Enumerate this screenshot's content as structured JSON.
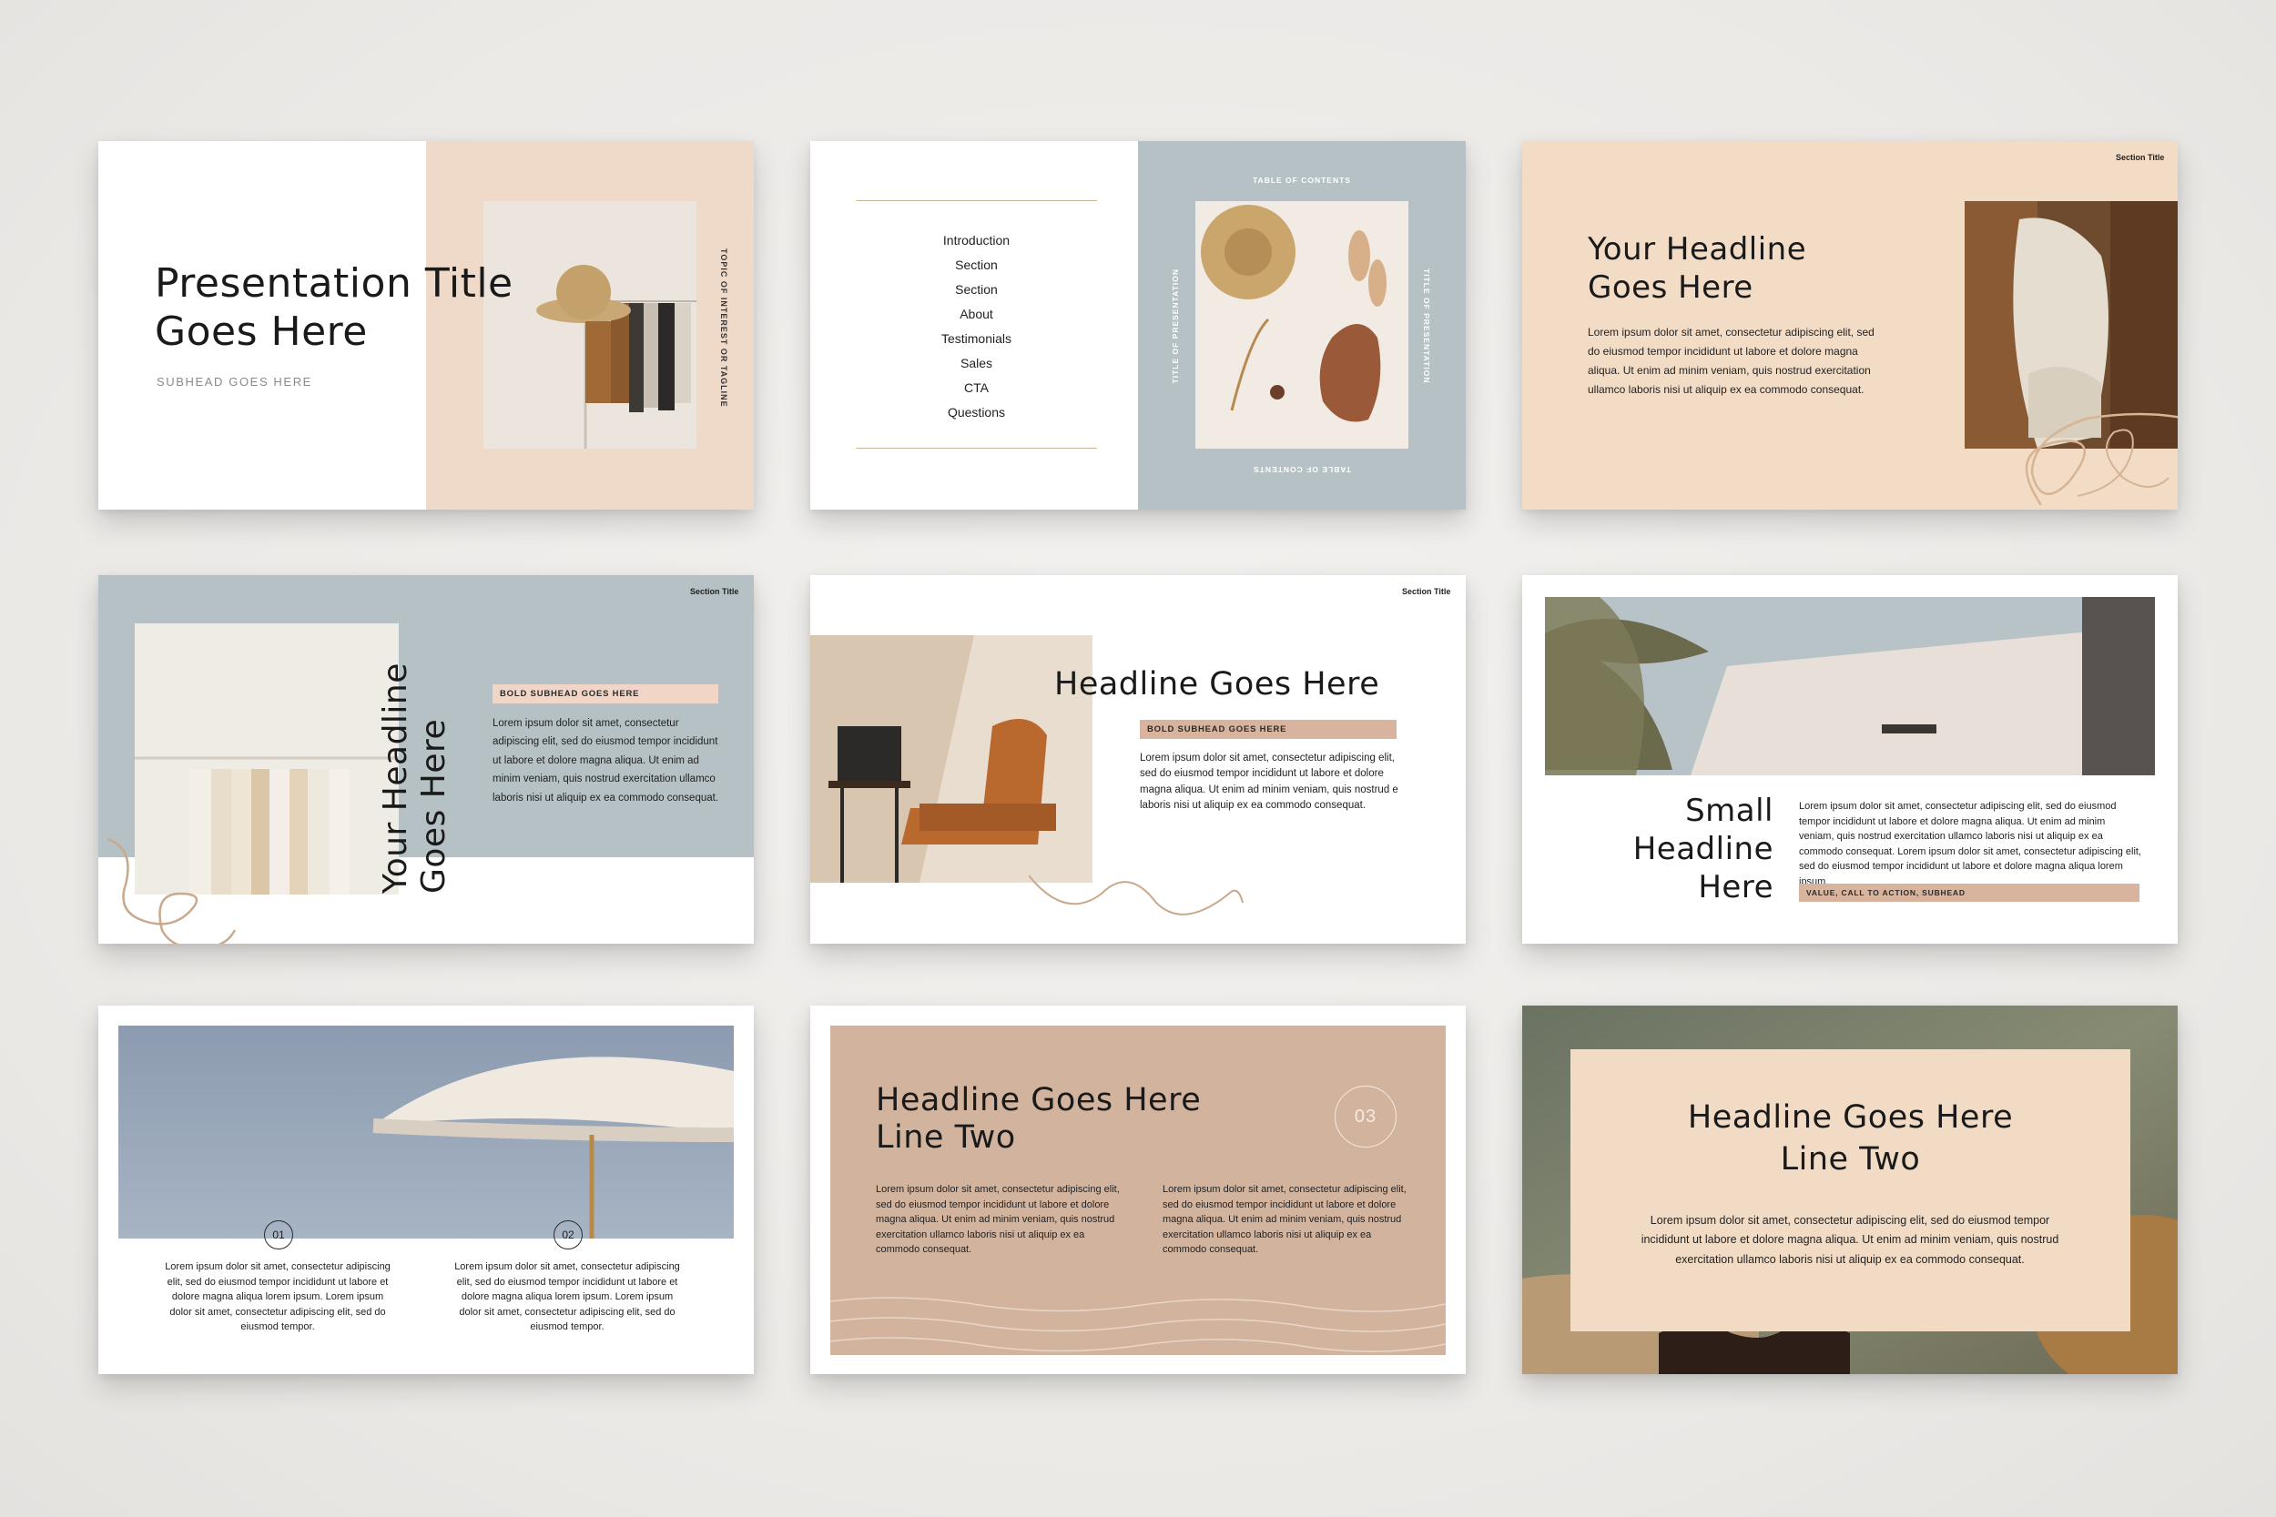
{
  "colors": {
    "blush": "#efd9c8",
    "peach": "#f3dcc6",
    "slate": "#b5c1c4",
    "tan": "#d2b39d",
    "badge": "#f1d6c7"
  },
  "slide1": {
    "title_line1": "Presentation Title",
    "title_line2": "Goes Here",
    "subhead": "SUBHEAD GOES HERE",
    "vertical_tagline": "TOPIC OF INTEREST OR TAGLINE"
  },
  "slide2": {
    "toc_items": [
      "Introduction",
      "Section",
      "Section",
      "About",
      "Testimonials",
      "Sales",
      "CTA",
      "Questions"
    ],
    "top_label": "TABLE OF CONTENTS",
    "bottom_label": "TABLE OF CONTENTS",
    "left_vertical": "TITLE OF PRESENTATION",
    "right_vertical": "TITLE OF PRESENTATION"
  },
  "slide3": {
    "section_title": "Section Title",
    "headline_line1": "Your Headline",
    "headline_line2": "Goes Here",
    "body": "Lorem ipsum dolor sit amet, consectetur adipiscing elit, sed do eiusmod tempor incididunt ut labore et dolore magna aliqua. Ut enim ad minim veniam, quis nostrud exercitation ullamco laboris nisi ut aliquip ex ea commodo consequat."
  },
  "slide4": {
    "section_title": "Section Title",
    "headline_line1": "Your Headline",
    "headline_line2": "Goes Here",
    "badge": "BOLD SUBHEAD GOES HERE",
    "body": "Lorem ipsum dolor sit amet, consectetur adipiscing elit, sed do eiusmod tempor incididunt ut labore et dolore magna aliqua. Ut enim ad minim veniam, quis nostrud exercitation ullamco laboris nisi ut aliquip ex ea commodo consequat."
  },
  "slide5": {
    "section_title": "Section Title",
    "headline": "Headline Goes Here",
    "badge": "BOLD SUBHEAD GOES HERE",
    "body": "Lorem ipsum dolor sit amet, consectetur adipiscing elit, sed do eiusmod tempor incididunt ut labore et dolore magna aliqua. Ut enim ad minim veniam, quis nostrud e laboris nisi ut aliquip ex ea commodo consequat."
  },
  "slide6": {
    "headline_line1": "Small",
    "headline_line2": "Headline",
    "headline_line3": "Here",
    "body": "Lorem ipsum dolor sit amet, consectetur adipiscing elit, sed do eiusmod tempor incididunt ut labore et dolore magna aliqua. Ut enim ad minim veniam, quis nostrud exercitation ullamco laboris nisi ut aliquip ex ea commodo consequat. Lorem ipsum dolor sit amet, consectetur adipiscing elit, sed do eiusmod tempor incididunt ut labore et dolore magna aliqua lorem ipsum.",
    "badge": "VALUE, CALL TO ACTION, SUBHEAD"
  },
  "slide7": {
    "num1": "01",
    "num2": "02",
    "body1": "Lorem ipsum dolor sit amet, consectetur adipiscing elit, sed do eiusmod tempor incididunt ut labore et dolore magna aliqua lorem ipsum. Lorem ipsum dolor sit amet, consectetur adipiscing elit, sed do eiusmod tempor.",
    "body2": "Lorem ipsum dolor sit amet, consectetur adipiscing elit, sed do eiusmod tempor incididunt ut labore et dolore magna aliqua lorem ipsum. Lorem ipsum dolor sit amet, consectetur adipiscing elit, sed do eiusmod tempor."
  },
  "slide8": {
    "headline_line1": "Headline Goes Here",
    "headline_line2": "Line Two",
    "number": "03",
    "body1": "Lorem ipsum dolor sit amet, consectetur adipiscing elit, sed do eiusmod tempor incididunt ut labore et dolore magna aliqua. Ut enim ad minim veniam, quis nostrud exercitation ullamco laboris nisi ut aliquip ex ea commodo consequat.",
    "body2": "Lorem ipsum dolor sit amet, consectetur adipiscing elit, sed do eiusmod tempor incididunt ut labore et dolore magna aliqua. Ut enim ad minim veniam, quis nostrud exercitation ullamco laboris nisi ut aliquip ex ea commodo consequat."
  },
  "slide9": {
    "headline_line1": "Headline Goes Here",
    "headline_line2": "Line Two",
    "body": "Lorem ipsum dolor sit amet, consectetur adipiscing elit, sed do eiusmod tempor incididunt ut labore et dolore magna aliqua. Ut enim ad minim veniam, quis nostrud exercitation ullamco laboris nisi ut aliquip ex ea commodo consequat."
  }
}
